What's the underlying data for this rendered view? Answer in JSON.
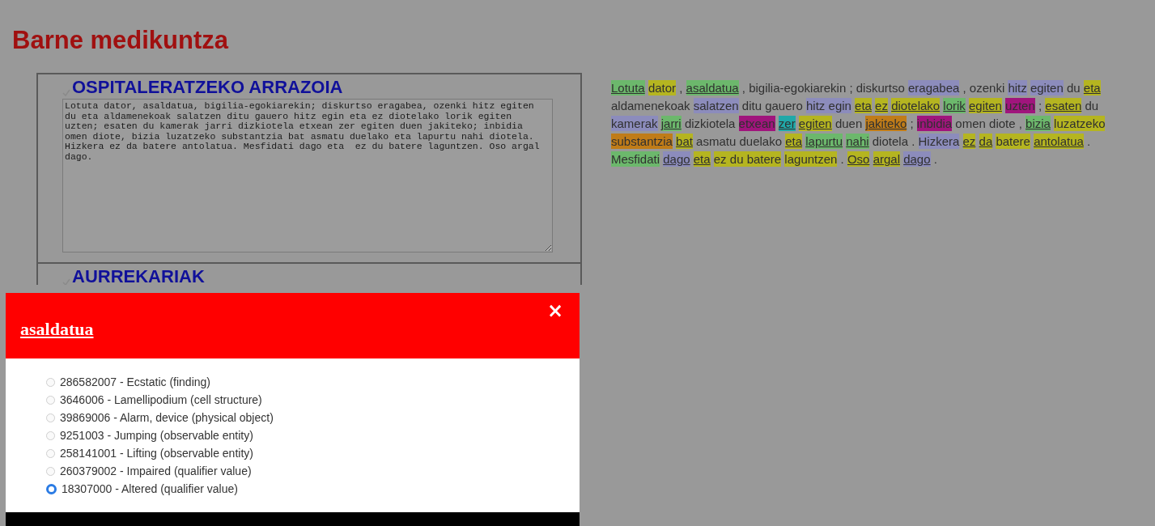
{
  "page_title": "Barne medikuntza",
  "sections": [
    {
      "title": "OSPITALERATZEKO ARRAZOIA",
      "text": "Lotuta dator, asaldatua, bigilia-egokiarekin; diskurtso eragabea, ozenki hitz egiten du eta aldamenekoak salatzen ditu gauero hitz egin eta ez diotelako lorik egiten uzten; esaten du kamerak jarri dizkiotela etxean zer egiten duen jakiteko; inbidia omen diote, bizia luzatzeko substantzia bat asmatu duelako eta lapurtu nahi diotela. Hizkera ez da batere antolatua. Mesfidati dago eta  ez du batere laguntzen. Oso argal dago."
    },
    {
      "title": "AURREKARIAK"
    }
  ],
  "annotated_text": [
    {
      "text": "Lotuta",
      "color": "#6cb86c",
      "underline": true
    },
    {
      "text": "dator",
      "color": "#b5b520",
      "underline": false
    },
    {
      "text": ","
    },
    {
      "text": "asaldatua",
      "color": "#6cb86c",
      "underline": true
    },
    {
      "text": ", bigilia-egokiarekin ; diskurtso"
    },
    {
      "text": "eragabea",
      "color": "#8c8cbc",
      "underline": false
    },
    {
      "text": ", ozenki"
    },
    {
      "text": "hitz",
      "color": "#8c8cbc",
      "underline": false
    },
    {
      "text": "egiten",
      "color": "#8c8cbc",
      "underline": false
    },
    {
      "text": "du"
    },
    {
      "text": "eta",
      "color": "#b5b520",
      "underline": true
    },
    {
      "text": "aldamenekoak"
    },
    {
      "text": "salatzen",
      "color": "#8c8cbc",
      "underline": false
    },
    {
      "text": "ditu gauero"
    },
    {
      "text": "hitz egin",
      "color": "#8c8cbc",
      "underline": false
    },
    {
      "text": "eta",
      "color": "#b5b520",
      "underline": true
    },
    {
      "text": "ez",
      "color": "#b5b520",
      "underline": true
    },
    {
      "text": "diotelako",
      "color": "#b5b520",
      "underline": true
    },
    {
      "text": "lorik",
      "color": "#6cb86c",
      "underline": true
    },
    {
      "text": "egiten",
      "color": "#b5b520",
      "underline": true
    },
    {
      "text": "uzten",
      "color": "#a0157c",
      "underline": false
    },
    {
      "text": ";"
    },
    {
      "text": "esaten",
      "color": "#b5b520",
      "underline": true
    },
    {
      "text": "du"
    },
    {
      "text": "kamerak",
      "color": "#8c8cbc",
      "underline": false
    },
    {
      "text": "jarri",
      "color": "#6cb86c",
      "underline": true
    },
    {
      "text": "dizkiotela"
    },
    {
      "text": "etxean",
      "color": "#a0157c",
      "underline": false
    },
    {
      "text": "zer",
      "color": "#20a8a8",
      "underline": true
    },
    {
      "text": "egiten",
      "color": "#b5b520",
      "underline": true
    },
    {
      "text": "duen"
    },
    {
      "text": "jakiteko",
      "color": "#c07c18",
      "underline": true
    },
    {
      "text": ";"
    },
    {
      "text": "inbidia",
      "color": "#a0157c",
      "underline": false
    },
    {
      "text": "omen diote ,"
    },
    {
      "text": "bizia",
      "color": "#6cb86c",
      "underline": true
    },
    {
      "text": "luzatzeko",
      "color": "#b5b520",
      "underline": false
    },
    {
      "text": "substantzia",
      "color": "#c07c18",
      "underline": false
    },
    {
      "text": "bat",
      "color": "#b5b520",
      "underline": true
    },
    {
      "text": "asmatu duelako"
    },
    {
      "text": "eta",
      "color": "#b5b520",
      "underline": true
    },
    {
      "text": "lapurtu",
      "color": "#6cb86c",
      "underline": true
    },
    {
      "text": "nahi",
      "color": "#6cb86c",
      "underline": true
    },
    {
      "text": "diotela ."
    },
    {
      "text": "Hizkera",
      "color": "#8c8cbc",
      "underline": false
    },
    {
      "text": "ez",
      "color": "#b5b520",
      "underline": true
    },
    {
      "text": "da",
      "color": "#b5b520",
      "underline": true
    },
    {
      "text": "batere",
      "color": "#b5b520",
      "underline": false
    },
    {
      "text": "antolatua",
      "color": "#b5b520",
      "underline": true
    },
    {
      "text": "."
    },
    {
      "text": "Mesfidati",
      "color": "#6cb86c",
      "underline": false
    },
    {
      "text": "dago",
      "color": "#8c8cbc",
      "underline": true
    },
    {
      "text": "eta",
      "color": "#b5b520",
      "underline": true
    },
    {
      "text": "ez du batere",
      "color": "#b5b520",
      "underline": false
    },
    {
      "text": "laguntzen",
      "color": "#b5b520",
      "underline": false
    },
    {
      "text": "."
    },
    {
      "text": "Oso",
      "color": "#b5b520",
      "underline": true
    },
    {
      "text": "argal",
      "color": "#b5b520",
      "underline": true
    },
    {
      "text": "dago",
      "color": "#8c8cbc",
      "underline": true
    },
    {
      "text": "."
    }
  ],
  "dialog": {
    "title": "asaldatua",
    "close": "×",
    "options": [
      {
        "label": "286582007 - Ecstatic (finding)",
        "selected": false
      },
      {
        "label": "3646006 - Lamellipodium (cell structure)",
        "selected": false
      },
      {
        "label": "39869006 - Alarm, device (physical object)",
        "selected": false
      },
      {
        "label": "9251003 - Jumping (observable entity)",
        "selected": false
      },
      {
        "label": "258141001 - Lifting (observable entity)",
        "selected": false
      },
      {
        "label": "260379002 - Impaired (qualifier value)",
        "selected": false
      },
      {
        "label": "18307000 - Altered (qualifier value)",
        "selected": true
      }
    ]
  }
}
